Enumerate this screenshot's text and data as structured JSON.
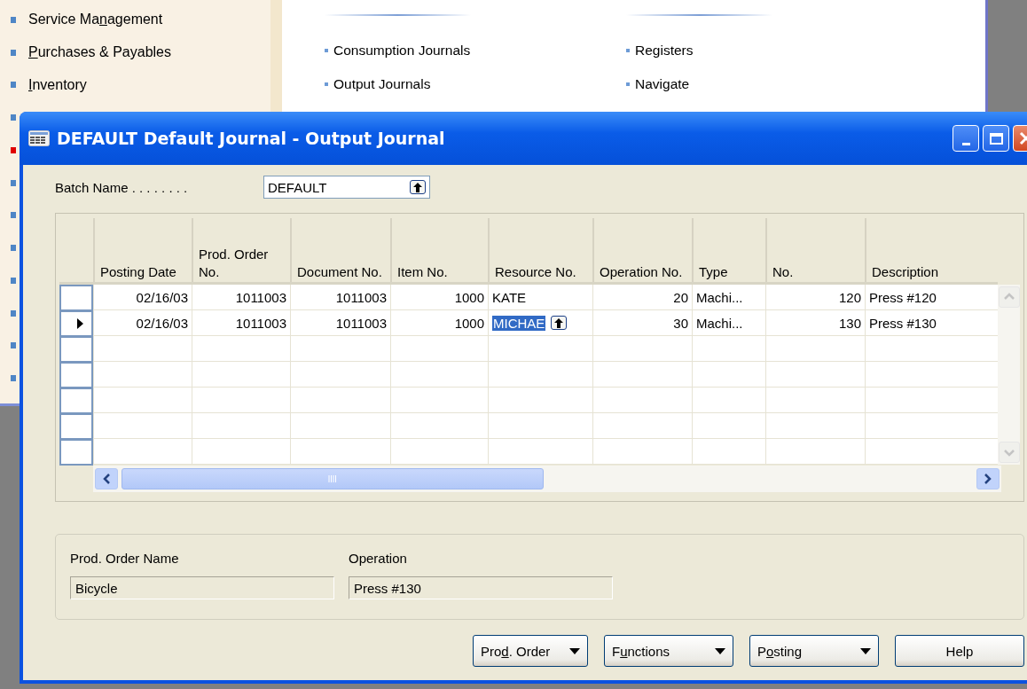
{
  "sidebar": {
    "items": [
      {
        "pre": "Service Ma",
        "key": "n",
        "post": "agement",
        "color": "#4f86c6"
      },
      {
        "key": "P",
        "post": "urchases & Payables",
        "color": "#4f86c6"
      },
      {
        "key": "I",
        "post": "nventory",
        "color": "#4f86c6"
      },
      {
        "color": "#4f86c6"
      },
      {
        "color": "#e00000"
      },
      {
        "color": "#4f86c6"
      },
      {
        "color": "#4f86c6"
      },
      {
        "color": "#4f86c6"
      },
      {
        "color": "#4f86c6"
      },
      {
        "color": "#4f86c6"
      },
      {
        "color": "#4f86c6"
      },
      {
        "color": "#4f86c6"
      }
    ]
  },
  "content": {
    "columns": [
      [
        "Consumption Journals",
        "Output Journals"
      ],
      [
        "Registers",
        "Navigate"
      ]
    ]
  },
  "window": {
    "title": "DEFAULT Default Journal - Output Journal"
  },
  "batch": {
    "label": "Batch Name . . . . . . . .",
    "value": "DEFAULT"
  },
  "table": {
    "columns": [
      {
        "label": "Posting Date",
        "numeric": true,
        "focused": false
      },
      {
        "label": "Prod. Order No.",
        "numeric": true,
        "focused": false
      },
      {
        "label": "Document No.",
        "numeric": true,
        "focused": false
      },
      {
        "label": "Item No.",
        "numeric": true,
        "focused": false
      },
      {
        "label": "Resource No.",
        "numeric": false,
        "focused": true
      },
      {
        "label": "Operation No.",
        "numeric": true,
        "focused": false
      },
      {
        "label": "Type",
        "numeric": false,
        "focused": false
      },
      {
        "label": "No.",
        "numeric": true,
        "focused": false
      },
      {
        "label": "Description",
        "numeric": false,
        "focused": false
      }
    ],
    "rows": [
      {
        "current": false,
        "cells": [
          "02/16/03",
          "1011003",
          "1011003",
          "1000",
          "KATE",
          "20",
          "Machi...",
          "120",
          "Press #120"
        ]
      },
      {
        "current": true,
        "cells": [
          "02/16/03",
          "1011003",
          "1011003",
          "1000",
          "MICHAE",
          "30",
          "Machi...",
          "130",
          "Press #130"
        ]
      }
    ]
  },
  "details": [
    {
      "label": "Prod. Order Name",
      "value": "Bicycle"
    },
    {
      "label": "Operation",
      "value": "Press #130"
    }
  ],
  "buttons": [
    {
      "pre": "Pro",
      "key": "d",
      "post": ". Order",
      "kind": "menu"
    },
    {
      "pre": "F",
      "key": "u",
      "post": "nctions",
      "kind": "menu"
    },
    {
      "pre": "P",
      "key": "o",
      "post": "sting",
      "kind": "menu"
    },
    {
      "label": "Help",
      "kind": "plain"
    }
  ]
}
